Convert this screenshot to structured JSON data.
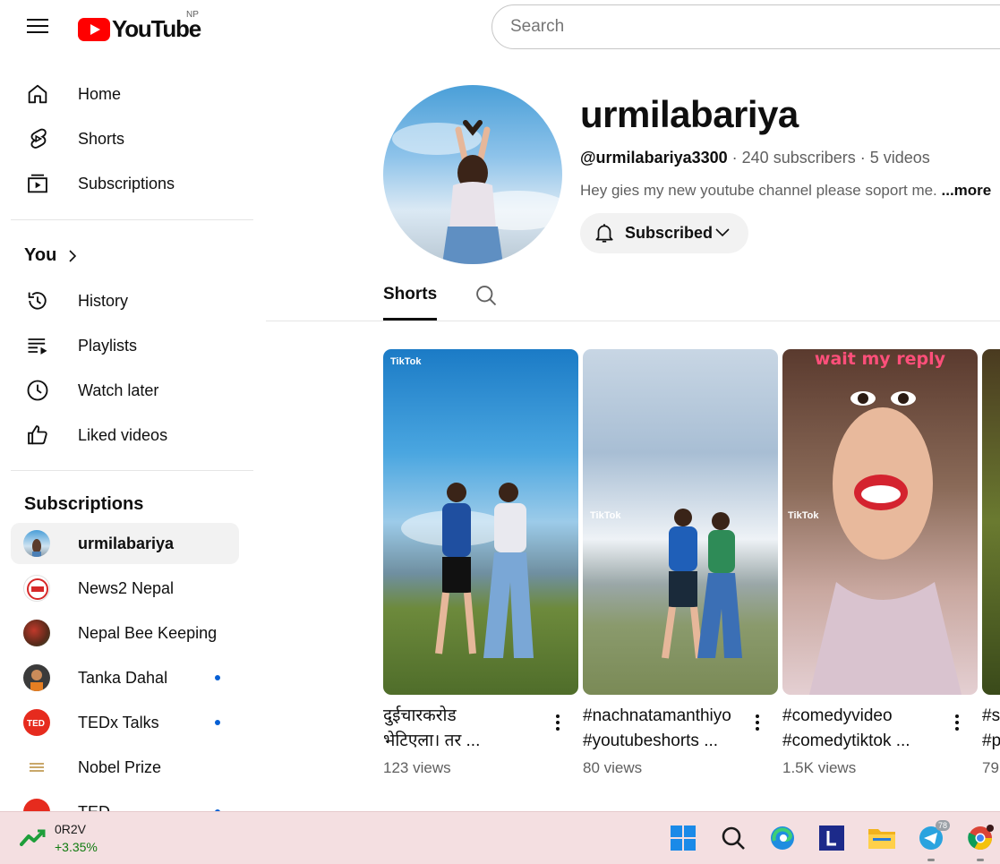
{
  "header": {
    "logo_text": "YouTube",
    "country_code": "NP",
    "search_placeholder": "Search"
  },
  "sidebar": {
    "main": [
      {
        "label": "Home",
        "icon": "home-icon"
      },
      {
        "label": "Shorts",
        "icon": "shorts-icon"
      },
      {
        "label": "Subscriptions",
        "icon": "subscriptions-icon"
      }
    ],
    "you_title": "You",
    "you_items": [
      {
        "label": "History",
        "icon": "history-icon"
      },
      {
        "label": "Playlists",
        "icon": "playlists-icon"
      },
      {
        "label": "Watch later",
        "icon": "clock-icon"
      },
      {
        "label": "Liked videos",
        "icon": "thumbs-up-icon"
      }
    ],
    "subscriptions_title": "Subscriptions",
    "subscriptions": [
      {
        "label": "urmilabariya",
        "active": true,
        "new": false
      },
      {
        "label": "News2 Nepal",
        "active": false,
        "new": false
      },
      {
        "label": "Nepal Bee Keeping",
        "active": false,
        "new": false
      },
      {
        "label": "Tanka Dahal",
        "active": false,
        "new": true
      },
      {
        "label": "TEDx Talks",
        "active": false,
        "new": true
      },
      {
        "label": "Nobel Prize",
        "active": false,
        "new": false
      },
      {
        "label": "TED",
        "active": false,
        "new": true
      }
    ]
  },
  "channel": {
    "name": "urmilabariya",
    "handle": "@urmilabariya3300",
    "subscribers": "240 subscribers",
    "videos": "5 videos",
    "separator": " · ",
    "description": "Hey gies my new youtube channel please soport me. ",
    "more_label": "...more",
    "subscribe_label": "Subscribed"
  },
  "tabs": {
    "active_label": "Shorts"
  },
  "shorts": [
    {
      "title_line1": "दुईचारकरोड",
      "title_line2": "भेटिएला। तर ...",
      "views": "123 views",
      "watermark": "TikTok",
      "overlay": ""
    },
    {
      "title_line1": "#nachnatamanthiyo",
      "title_line2": "#youtubeshorts ...",
      "views": "80 views",
      "watermark": "TikTok",
      "overlay": ""
    },
    {
      "title_line1": "#comedyvideo",
      "title_line2": "#comedytiktok ...",
      "views": "1.5K views",
      "watermark": "TikTok",
      "overlay": "wait my reply"
    },
    {
      "title_line1": "#s",
      "title_line2": "#p",
      "views": "79",
      "watermark": "",
      "overlay": ""
    }
  ],
  "taskbar": {
    "ticker_symbol": "0R2V",
    "ticker_change": "+3.35%",
    "telegram_badge": "78",
    "apps": [
      "windows-start-icon",
      "search-icon",
      "edge-browser-icon",
      "l-app-icon",
      "file-explorer-icon",
      "telegram-icon",
      "chrome-icon"
    ]
  }
}
